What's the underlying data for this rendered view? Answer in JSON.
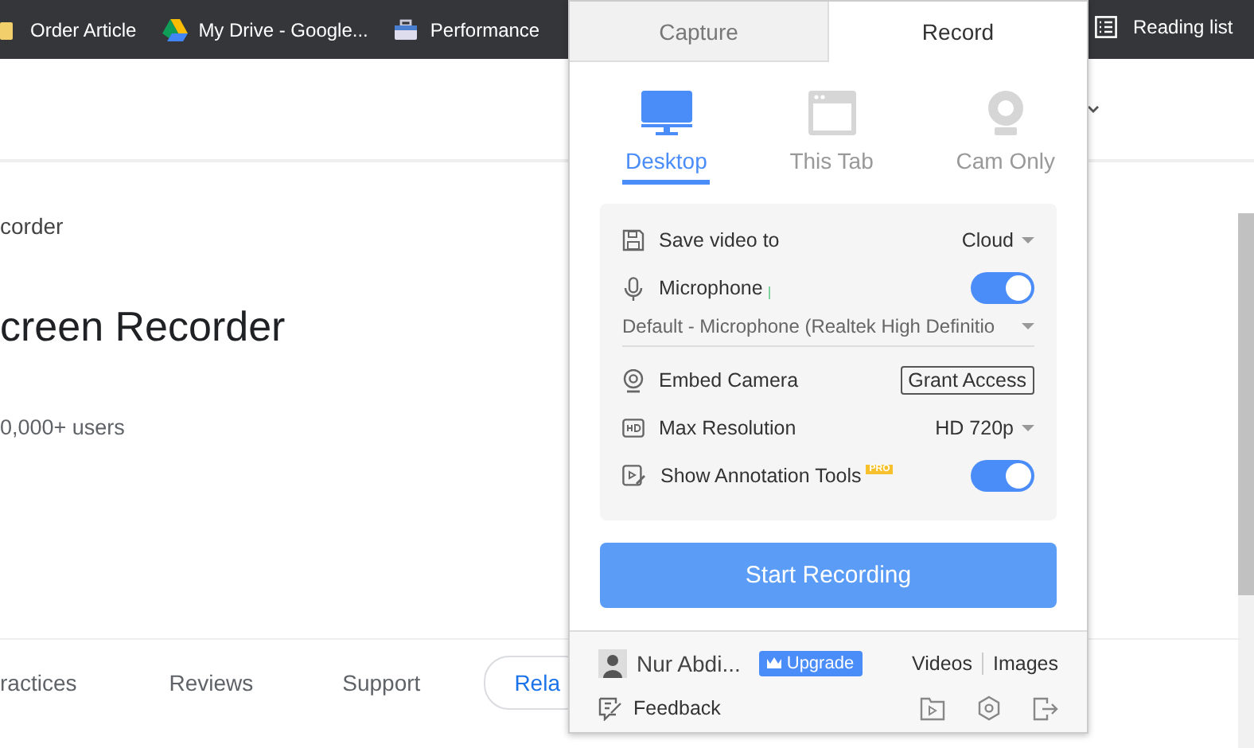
{
  "bookmarks": [
    {
      "label": "Order Article",
      "kind": "folder"
    },
    {
      "label": "My Drive - Google...",
      "kind": "drive"
    },
    {
      "label": "Performance",
      "kind": "site"
    }
  ],
  "reading_list": {
    "label": "Reading list"
  },
  "page": {
    "breadcrumb": "corder",
    "title": "creen Recorder",
    "users": "0,000+ users",
    "tabs": [
      {
        "label": "ractices",
        "selected": false
      },
      {
        "label": "Reviews",
        "selected": false
      },
      {
        "label": "Support",
        "selected": false
      },
      {
        "label": "Rela",
        "selected": true
      }
    ]
  },
  "popup": {
    "tabs": [
      {
        "label": "Capture",
        "selected": false
      },
      {
        "label": "Record",
        "selected": true
      }
    ],
    "modes": [
      {
        "label": "Desktop",
        "kind": "desktop",
        "selected": true
      },
      {
        "label": "This Tab",
        "kind": "tab",
        "selected": false
      },
      {
        "label": "Cam Only",
        "kind": "cam",
        "selected": false
      }
    ],
    "settings": [
      {
        "kind": "select",
        "label": "Save video to",
        "value": "Cloud"
      },
      {
        "kind": "toggle",
        "label": "Microphone",
        "on": true
      },
      {
        "kind": "device",
        "value": "Default - Microphone (Realtek High Definitio"
      },
      {
        "kind": "button",
        "label": "Embed Camera",
        "value": "Grant Access"
      },
      {
        "kind": "select",
        "label": "Max Resolution",
        "value": "HD 720p"
      },
      {
        "kind": "toggle",
        "label": "Show Annotation Tools",
        "badge": "PRO",
        "on": true
      }
    ],
    "start_button": "Start Recording",
    "user": {
      "name": "Nur Abdi...",
      "upgrade": "Upgrade"
    },
    "links": [
      "Videos",
      "Images"
    ],
    "feedback": "Feedback"
  }
}
